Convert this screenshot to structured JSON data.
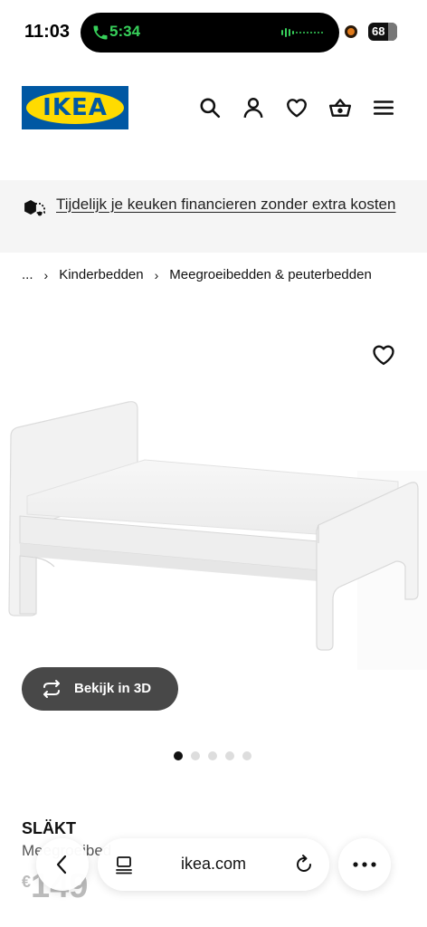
{
  "status_bar": {
    "time": "11:03",
    "call_time": "5:34",
    "battery": "68"
  },
  "header": {
    "logo_text": "IKEA",
    "icons": [
      "search-icon",
      "account-icon",
      "heart-icon",
      "basket-icon",
      "menu-icon"
    ]
  },
  "promo": {
    "text": "Tijdelijk je keuken financieren zonder extra kosten"
  },
  "breadcrumb": {
    "items": [
      "...",
      "Kinderbedden",
      "Meegroeibedden & peuterbedden"
    ],
    "separator": "›"
  },
  "gallery": {
    "view3d_label": "Bekijk in 3D",
    "dot_count": 5,
    "active_index": 0
  },
  "product": {
    "name": "SLÄKT",
    "description": "Meegroeibed",
    "currency": "€",
    "price": "149"
  },
  "browser": {
    "url": "ikea.com"
  },
  "colors": {
    "ikea_blue": "#0058a3",
    "ikea_yellow": "#ffdb00",
    "call_green": "#37d05a",
    "button_dark": "#484848"
  }
}
